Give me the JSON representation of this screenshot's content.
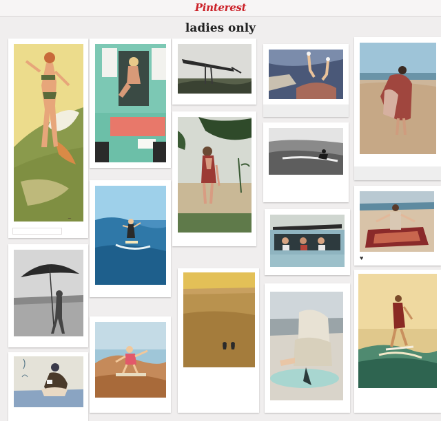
{
  "header": {
    "logo_text": "Pinterest",
    "brand_color": "#cb2027"
  },
  "board": {
    "title": "ladies only"
  },
  "pins": [
    {
      "id": "pin-1",
      "alt": "illustrated surfer woman in bikini on green wave"
    },
    {
      "id": "pin-2",
      "alt": "woman sitting in teal vintage van door"
    },
    {
      "id": "pin-3",
      "alt": "person carrying surfboard overhead on beach"
    },
    {
      "id": "pin-4",
      "alt": "woman lying on car dashboard with feet up"
    },
    {
      "id": "pin-5",
      "alt": "woman wrapped in patterned blanket on beach"
    },
    {
      "id": "pin-6",
      "alt": "woman in plaid shirt walking on beach under tree"
    },
    {
      "id": "pin-7",
      "alt": "surfer riding wave, black and white"
    },
    {
      "id": "pin-8",
      "alt": "woman surfing on blue wave"
    },
    {
      "id": "pin-9",
      "alt": "girls leaning out of vintage van windows"
    },
    {
      "id": "pin-10",
      "alt": "woman laying out tapestry on beach",
      "caption": "♥"
    },
    {
      "id": "pin-11",
      "alt": "woman holding beach umbrella, black and white"
    },
    {
      "id": "pin-12",
      "alt": "two people swimming at sunset"
    },
    {
      "id": "pin-13",
      "alt": "woman in hoodie sitting on surfboard"
    },
    {
      "id": "pin-14",
      "alt": "surfer girl at golden sunset"
    },
    {
      "id": "pin-15",
      "alt": "girl surfing in pink swimsuit"
    },
    {
      "id": "pin-16",
      "alt": "illustrated woman sitting on beach"
    }
  ]
}
